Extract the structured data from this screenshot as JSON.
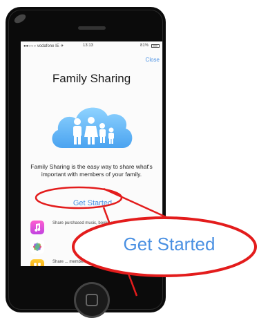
{
  "statusbar": {
    "carrier": "●●○○○ vodafone IE ✈",
    "time": "13:13",
    "battery": "81%"
  },
  "header": {
    "close_label": "Close"
  },
  "main": {
    "title": "Family Sharing",
    "description": "Family Sharing is the easy way to share what's important with members of your family.",
    "cta_label": "Get Started"
  },
  "features": [
    {
      "icon": "music-icon",
      "text": "Share purchased music, books and apps."
    },
    {
      "icon": "photos-icon",
      "text": ""
    },
    {
      "icon": "family-icon",
      "text": "Share ... members."
    }
  ],
  "callout": {
    "zoomed_label": "Get Started"
  },
  "colors": {
    "accent": "#4a90e2",
    "highlight": "#e31c1c"
  }
}
